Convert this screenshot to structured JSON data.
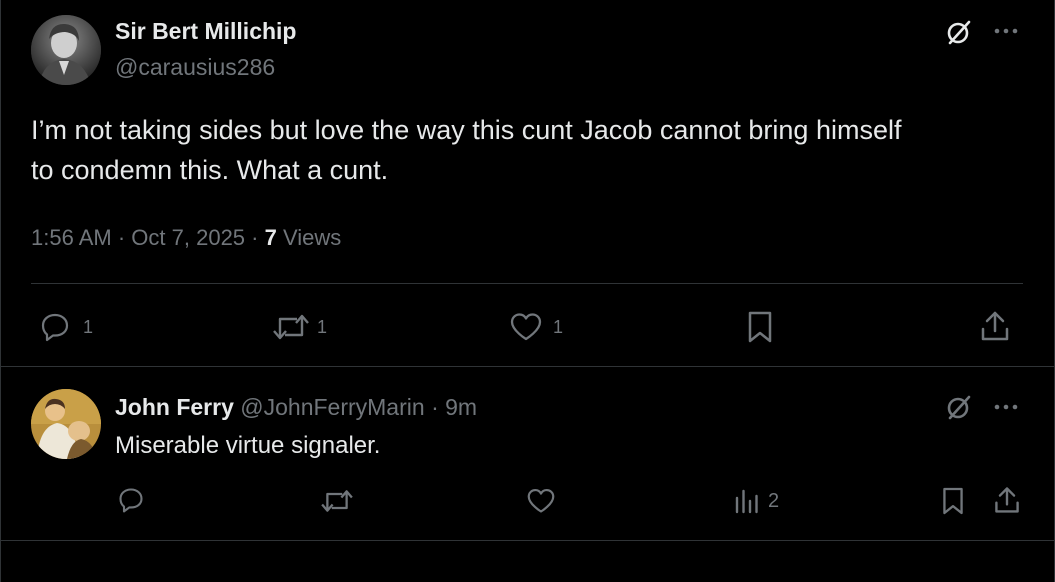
{
  "main_post": {
    "author_name": "Sir Bert Millichip",
    "author_handle": "@carausius286",
    "text_line1": "I’m not taking sides but love the way this cunt Jacob cannot bring himself",
    "text_line2": "to condemn this. What a cunt.",
    "time": "1:56 AM",
    "sep1": "·",
    "date": "Oct 7, 2025",
    "sep2": "·",
    "views_count": "7",
    "views_label": "Views",
    "actions": {
      "replies": "1",
      "reposts": "1",
      "likes": "1"
    },
    "icons": [
      "grok-icon",
      "more-icon",
      "reply-icon",
      "repost-icon",
      "like-icon",
      "bookmark-icon",
      "share-icon"
    ]
  },
  "reply": {
    "author_name": "John Ferry",
    "author_handle": "@JohnFerryMarin",
    "sep": "·",
    "time_ago": "9m",
    "text": "Miserable virtue signaler.",
    "actions": {
      "views": "2"
    },
    "icons": [
      "grok-icon",
      "more-icon",
      "reply-icon",
      "repost-icon",
      "like-icon",
      "analytics-icon",
      "bookmark-icon",
      "share-icon"
    ]
  },
  "colors": {
    "background": "#000000",
    "text": "#e7e9ea",
    "muted": "#71767b",
    "divider": "#2f3336"
  }
}
